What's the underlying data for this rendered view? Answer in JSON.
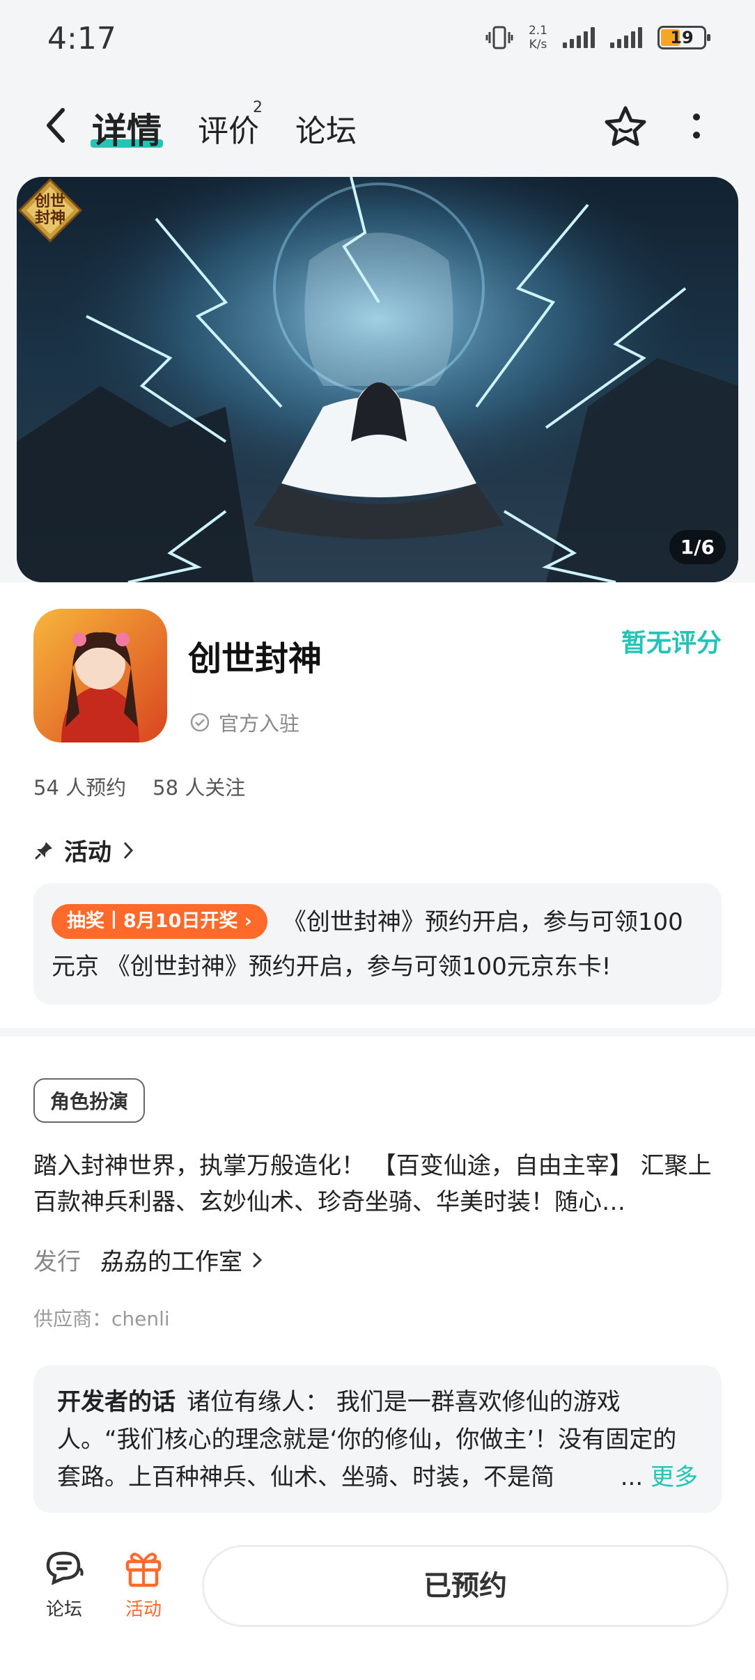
{
  "status": {
    "time": "4:17",
    "net_speed_top": "2.1",
    "net_speed_bottom": "K/s",
    "battery": "19"
  },
  "nav": {
    "tabs": [
      {
        "label": "详情",
        "active": true
      },
      {
        "label": "评价",
        "badge": "2"
      },
      {
        "label": "论坛"
      }
    ],
    "icons": [
      "back-arrow-icon",
      "star-icon",
      "more-vert-icon"
    ],
    "accent": "#25c3b5"
  },
  "hero": {
    "logo_text": "创世\n封神",
    "counter": "1/6"
  },
  "app": {
    "name": "创世封神",
    "rating": "暂无评分",
    "official": "官方入驻",
    "reservations": "54 人预约",
    "followers": "58 人关注"
  },
  "activity": {
    "heading": "活动",
    "tag": "抽奖丨8月10日开奖",
    "text": "《创世封神》预约开启，参与可领100元京 《创世封神》预约开启，参与可领100元京东卡!",
    "tag_color": "#ff6a2b"
  },
  "detail": {
    "genre": "角色扮演",
    "description": "踏入封神世界，执掌万般造化！ 【百变仙途，自由主宰】 汇聚上百款神兵利器、玄妙仙术、珍奇坐骑、华美时装！随心…",
    "publisher_label": "发行",
    "publisher": "劦劦的工作室",
    "supplier": "供应商：chenli"
  },
  "developer": {
    "title": "开发者的话",
    "text": "诸位有缘人： 我们是一群喜欢修仙的游戏人。“我们核心的理念就是‘你的修仙，你做主’！没有固定的套路。上百种神兵、仙术、坐骑、时装，不是简",
    "ellipsis": "...",
    "more": "更多"
  },
  "bottom": {
    "forum_label": "论坛",
    "activity_label": "活动",
    "reserve_label": "已预约",
    "active_color": "#ff6a2b"
  }
}
